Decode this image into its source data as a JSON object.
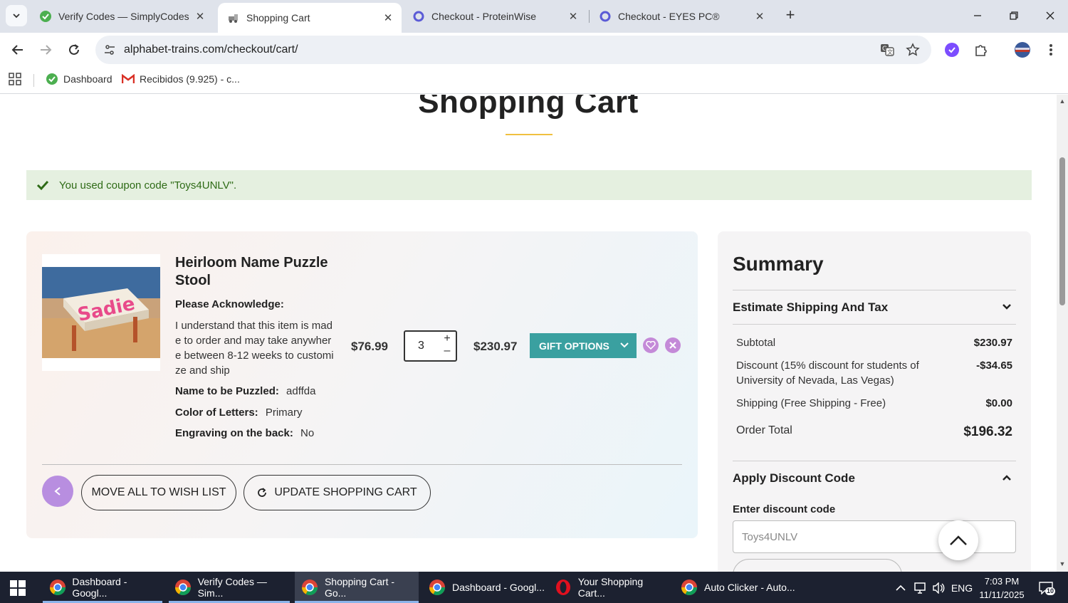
{
  "browser": {
    "tabs": [
      {
        "title": "Verify Codes — SimplyCodes"
      },
      {
        "title": "Shopping Cart"
      },
      {
        "title": "Checkout - ProteinWise"
      },
      {
        "title": "Checkout - EYES PC®"
      }
    ],
    "url": "alphabet-trains.com/checkout/cart/",
    "bookmarks": [
      {
        "label": "Dashboard"
      },
      {
        "label": "Recibidos (9.925) - c..."
      }
    ]
  },
  "page": {
    "title": "Shopping Cart",
    "coupon_message": "You used coupon code \"Toys4UNLV\".",
    "item": {
      "name": "Heirloom Name Puzzle Stool",
      "options_title": "Please Acknowledge:",
      "options_text": "I understand that this item is made to order and may take anywhere between 8-12 weeks to customize and ship",
      "name_label": "Name to be Puzzled:",
      "name_value": "adffda",
      "color_label": "Color of Letters:",
      "color_value": "Primary",
      "engraving_label": "Engraving on the back:",
      "engraving_value": "No",
      "price": "$76.99",
      "qty": "3",
      "line_total": "$230.97",
      "gift_options": "GIFT OPTIONS",
      "image_text": "Sadie"
    },
    "move_all": "MOVE ALL TO WISH LIST",
    "update_cart": "UPDATE SHOPPING CART"
  },
  "summary": {
    "title": "Summary",
    "estimate": "Estimate Shipping And Tax",
    "rows": [
      {
        "label": "Subtotal",
        "value": "$230.97"
      },
      {
        "label": "Discount (15% discount for students of University of Nevada, Las Vegas)",
        "value": "-$34.65"
      },
      {
        "label": "Shipping (Free Shipping - Free)",
        "value": "$0.00"
      },
      {
        "label": "Order Total",
        "value": "$196.32"
      }
    ],
    "apply_discount": "Apply Discount Code",
    "enter_code": "Enter discount code",
    "code_value": "Toys4UNLV"
  },
  "taskbar": {
    "items": [
      {
        "label": "Dashboard - Googl..."
      },
      {
        "label": "Verify Codes — Sim..."
      },
      {
        "label": "Shopping Cart - Go..."
      },
      {
        "label": "Dashboard - Googl..."
      },
      {
        "label": "Your Shopping Cart..."
      },
      {
        "label": "Auto Clicker - Auto..."
      }
    ],
    "lang": "ENG",
    "time": "7:03 PM",
    "date": "11/11/2025",
    "notifications": "10"
  },
  "colors": {
    "accent_teal": "#3aa0a0",
    "accent_purple": "#b88ee0",
    "coupon_green": "#2e6b16",
    "title_underline": "#f0c040"
  }
}
